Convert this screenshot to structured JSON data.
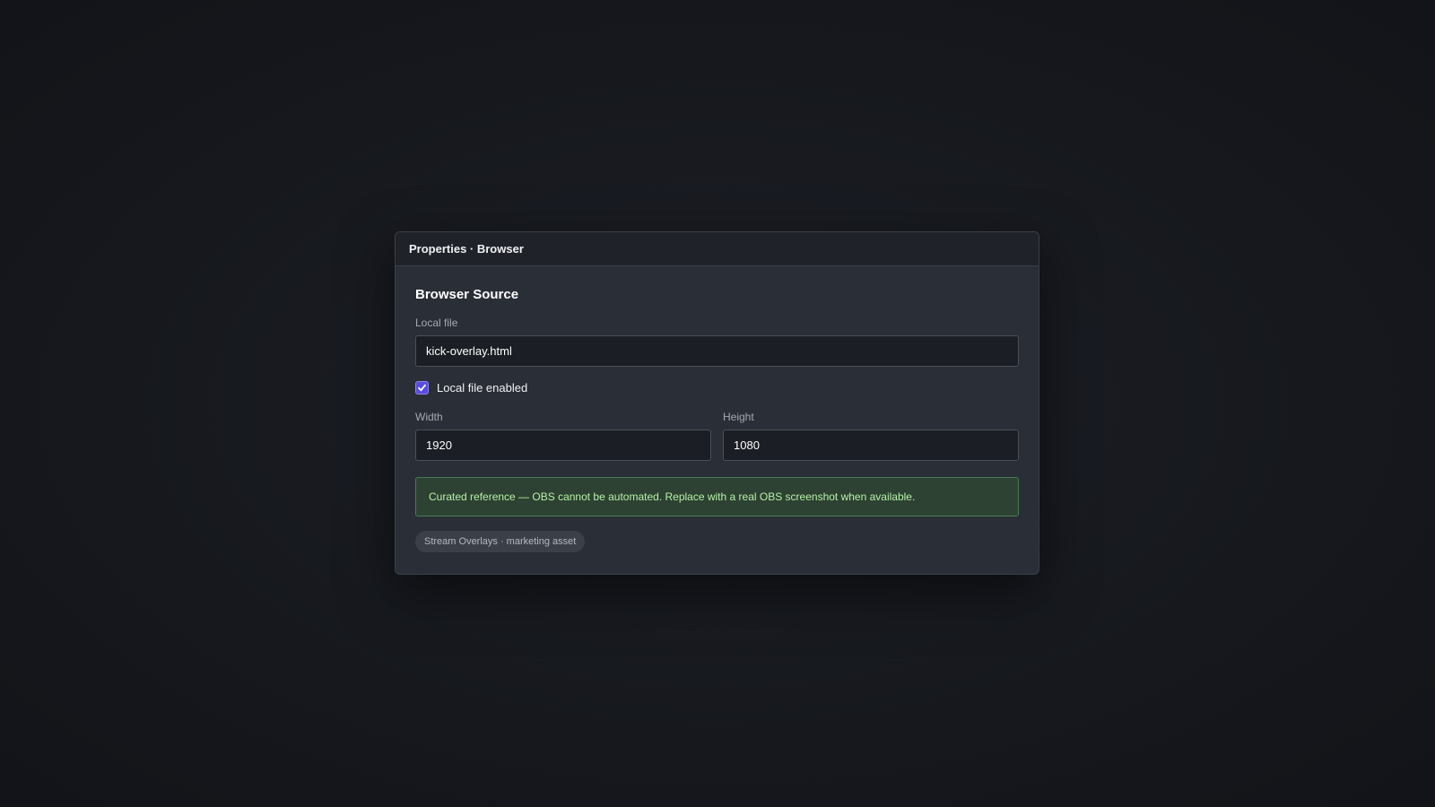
{
  "dialog": {
    "title": "Properties · Browser"
  },
  "form": {
    "section_title": "Browser Source",
    "local_file_label": "Local file",
    "local_file_value": "kick-overlay.html",
    "local_file_enabled_label": "Local file enabled",
    "local_file_enabled_checked": true,
    "width_label": "Width",
    "width_value": "1920",
    "height_label": "Height",
    "height_value": "1080"
  },
  "notice": {
    "text": "Curated reference — OBS cannot be automated. Replace with a real OBS screenshot when available."
  },
  "tag": {
    "text": "Stream Overlays · marketing asset"
  },
  "colors": {
    "accent": "#5b4ce0",
    "notice_bg": "#2d4232",
    "notice_text": "#b8f0a8"
  },
  "icons": {
    "checkbox": "checkmark-icon"
  }
}
